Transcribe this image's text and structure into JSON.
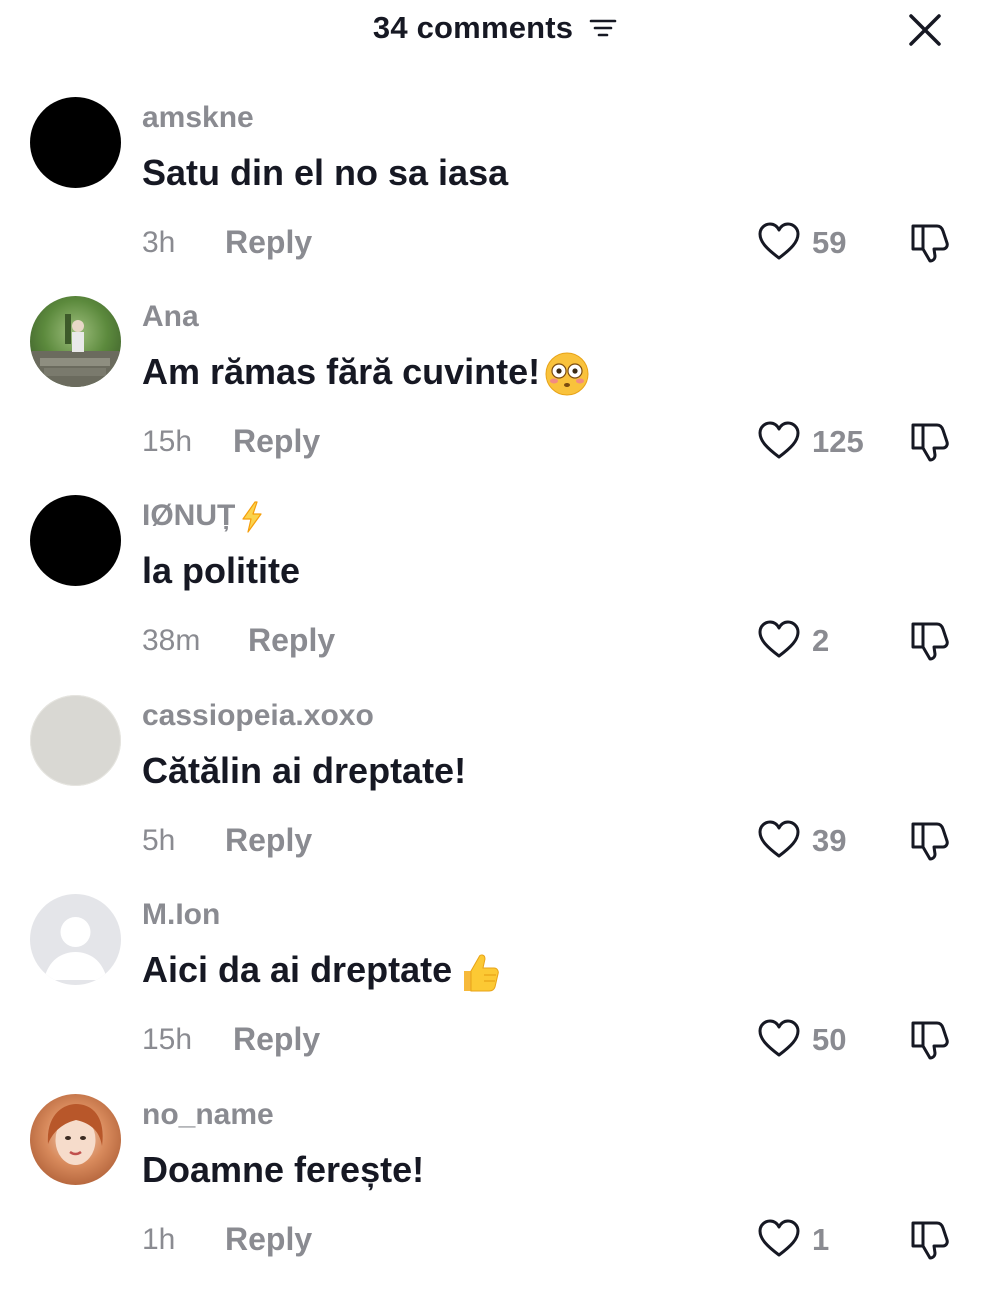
{
  "header": {
    "title": "34 comments",
    "sort_icon": "sort-filter-icon",
    "close_icon": "close-icon"
  },
  "comments": [
    {
      "username": "amskne",
      "text": "Satu din el no sa iasa",
      "time": "3h",
      "reply": "Reply",
      "likes": "59",
      "avatar": "black"
    },
    {
      "username": "Ana",
      "text": "Am rămas fără cuvinte!",
      "emoji": "flushed-face-emoji",
      "time": "15h",
      "reply": "Reply",
      "likes": "125",
      "avatar": "photo-forest"
    },
    {
      "username": "IØNUȚ",
      "username_emoji": "lightning-emoji",
      "text": "la politite",
      "time": "38m",
      "reply": "Reply",
      "likes": "2",
      "avatar": "black"
    },
    {
      "username": "cassiopeia.xoxo",
      "text": "Cătălin ai dreptate!",
      "time": "5h",
      "reply": "Reply",
      "likes": "39",
      "avatar": "light-gray"
    },
    {
      "username": "M.Ion",
      "text": "Aici da ai dreptate",
      "emoji": "thumbs-up-emoji",
      "time": "15h",
      "reply": "Reply",
      "likes": "50",
      "avatar": "default-user"
    },
    {
      "username": "no_name",
      "text": "Doamne ferește!",
      "time": "1h",
      "reply": "Reply",
      "likes": "1",
      "avatar": "photo-portrait"
    }
  ],
  "colors": {
    "text_primary": "#161823",
    "text_secondary": "#8a8b91",
    "background": "#ffffff"
  }
}
